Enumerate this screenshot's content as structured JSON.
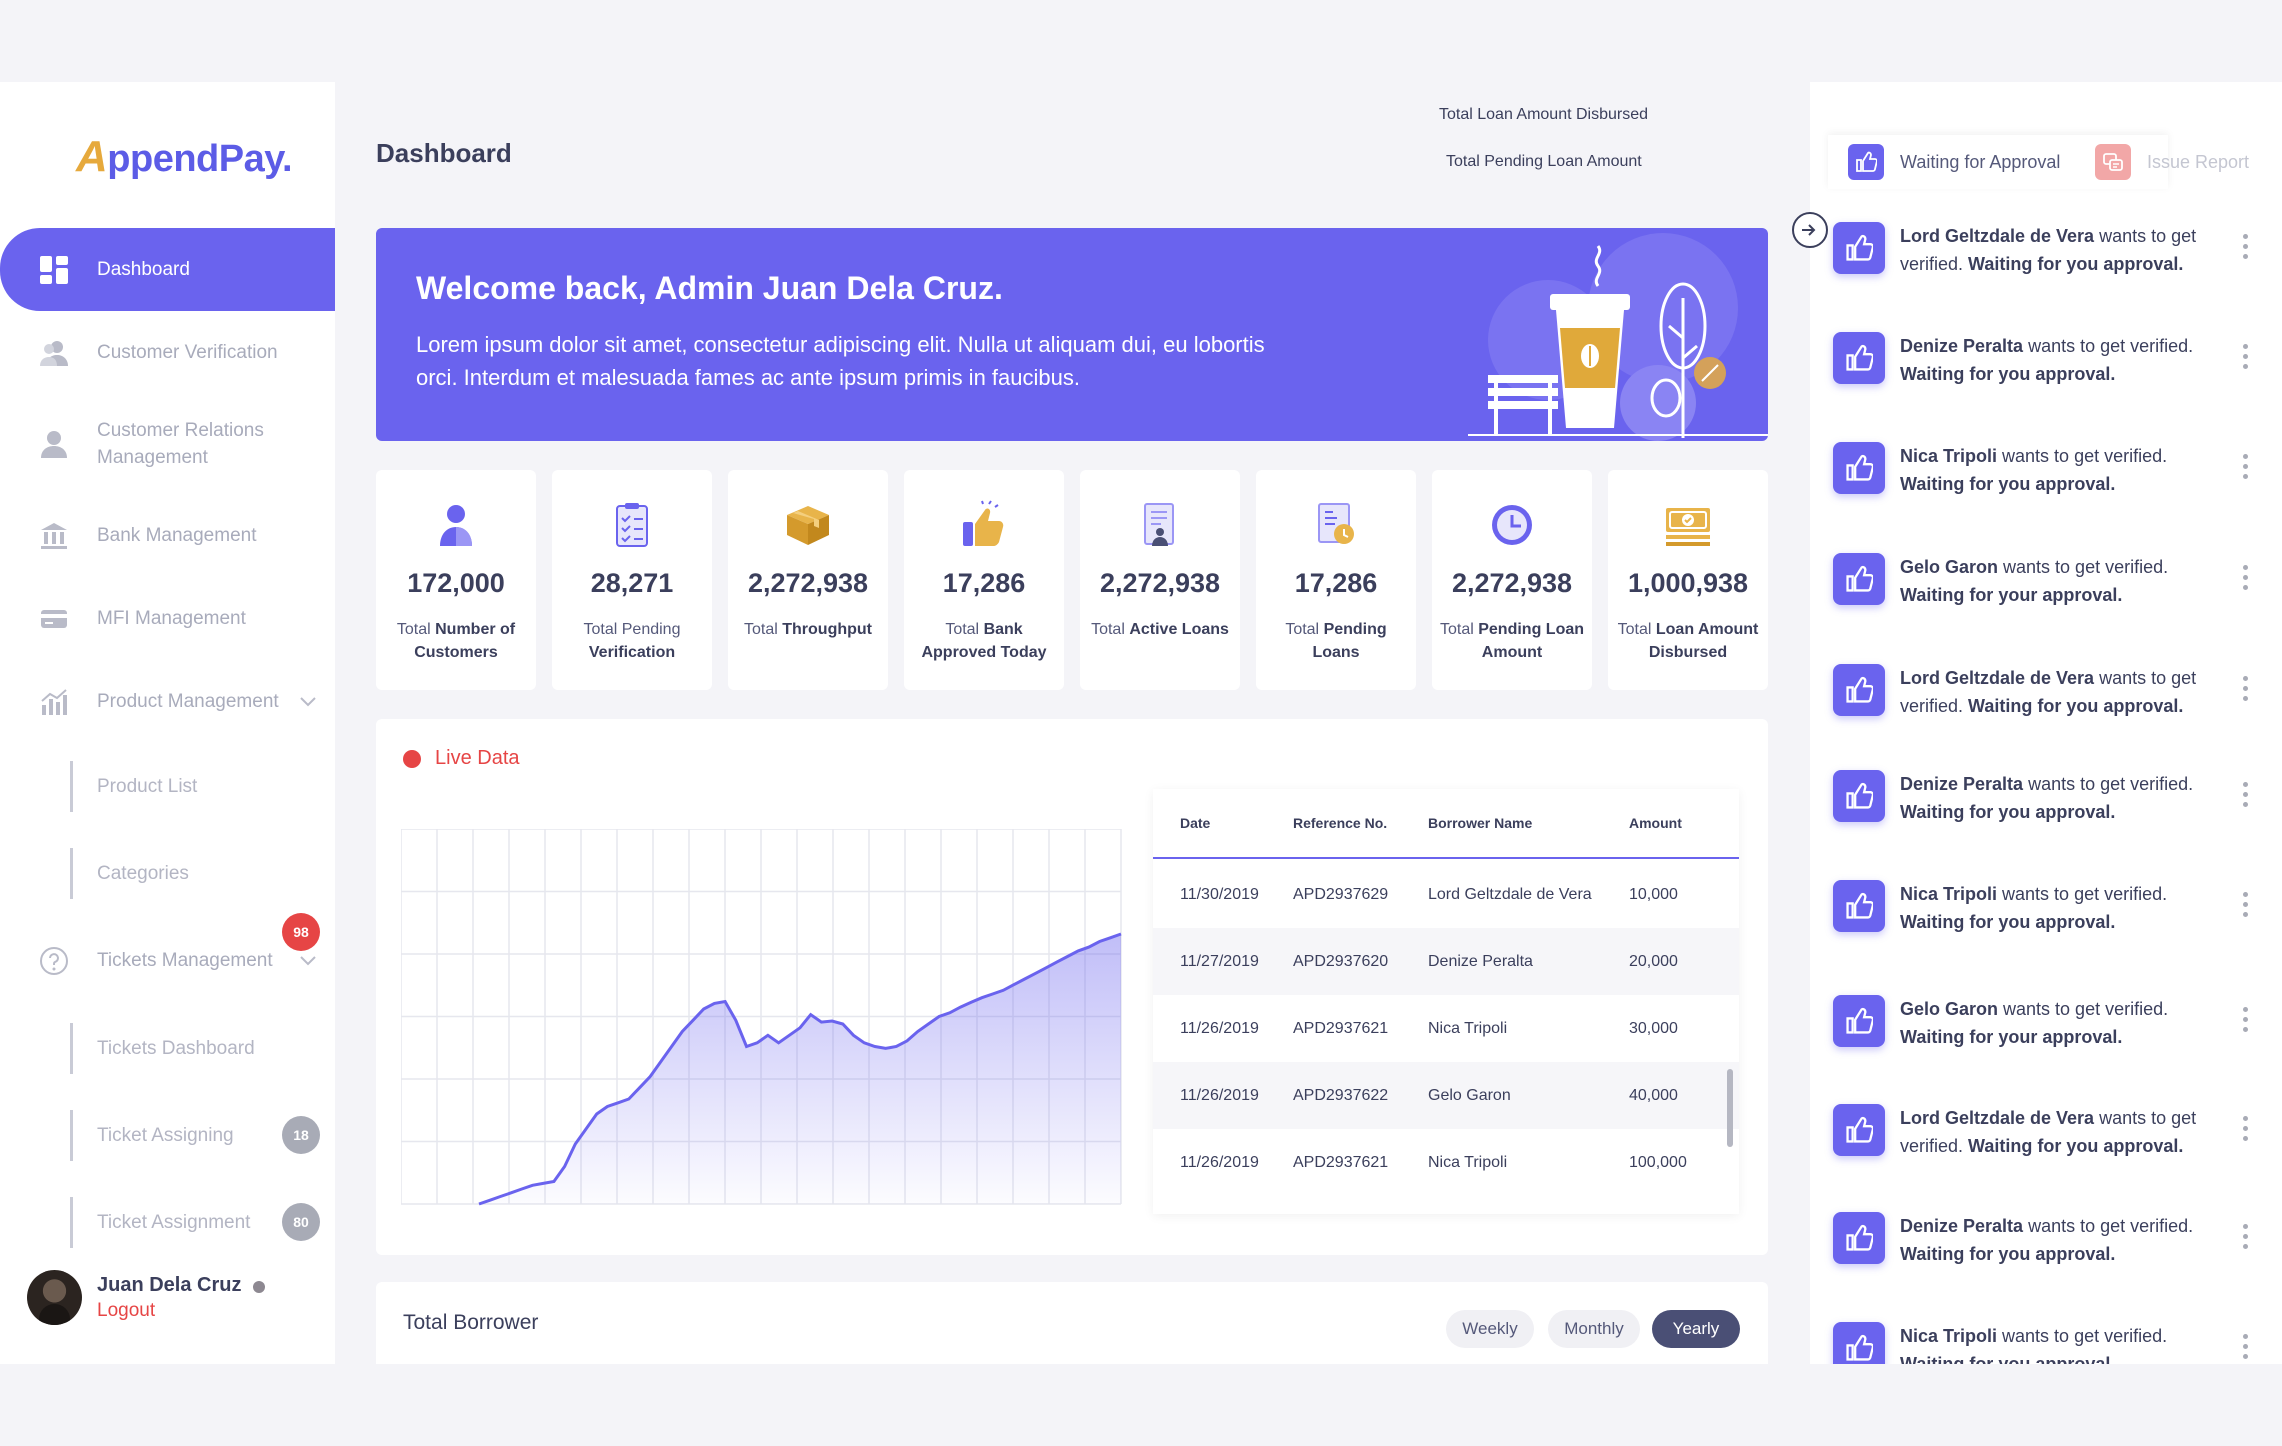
{
  "brand": {
    "logo_initial": "A",
    "logo_rest": "ppendPay."
  },
  "sidebar": {
    "items": [
      {
        "label": "Dashboard"
      },
      {
        "label": "Customer Verification"
      },
      {
        "label": "Customer Relations Management"
      },
      {
        "label": "Bank Management"
      },
      {
        "label": "MFI Management"
      },
      {
        "label": "Product Management"
      },
      {
        "label": "Product List"
      },
      {
        "label": "Categories"
      },
      {
        "label": "Tickets Management",
        "badge": "98"
      },
      {
        "label": "Tickets Dashboard"
      },
      {
        "label": "Ticket Assigning",
        "badge": "18"
      },
      {
        "label": "Ticket Assignment",
        "badge": "80"
      }
    ],
    "user": {
      "name": "Juan Dela Cruz",
      "logout_label": "Logout"
    }
  },
  "header": {
    "title": "Dashboard",
    "stat1_label": "Total Loan Amount Disbursed",
    "stat2_label": "Total Pending Loan Amount"
  },
  "banner": {
    "title": "Welcome back, Admin Juan Dela Cruz.",
    "text": "Lorem ipsum dolor sit amet, consectetur adipiscing elit. Nulla ut aliquam dui, eu lobortis orci. Interdum et malesuada fames ac ante ipsum primis in faucibus.",
    "cup_label": "Coffee"
  },
  "stats": [
    {
      "value": "172,000",
      "prefix": "Total ",
      "bold": "Number of Customers",
      "suffix": "",
      "icon": "user-icon"
    },
    {
      "value": "28,271",
      "prefix": "Total Pending ",
      "bold": "Verification",
      "suffix": "",
      "icon": "checklist-icon"
    },
    {
      "value": "2,272,938",
      "prefix": "Total ",
      "bold": "Throughput",
      "suffix": "",
      "icon": "box-icon"
    },
    {
      "value": "17,286",
      "prefix": "Total ",
      "bold": "Bank Approved Today",
      "suffix": "",
      "icon": "thumbs-up-icon"
    },
    {
      "value": "2,272,938",
      "prefix": "Total ",
      "bold": "Active Loans",
      "suffix": "",
      "icon": "document-user-icon"
    },
    {
      "value": "17,286",
      "prefix": "Total ",
      "bold": "Pending Loans",
      "suffix": "",
      "icon": "document-coin-icon"
    },
    {
      "value": "2,272,938",
      "prefix": "Total ",
      "bold": "Pending Loan Amount",
      "suffix": "",
      "icon": "clock-icon"
    },
    {
      "value": "1,000,938",
      "prefix": "Total ",
      "bold": "Loan Amount Disbursed",
      "suffix": "",
      "icon": "cash-icon"
    }
  ],
  "live": {
    "title": "Live Data",
    "columns": [
      "Date",
      "Reference No.",
      "Borrower Name",
      "Amount"
    ],
    "rows": [
      [
        "11/30/2019",
        "APD2937629",
        "Lord Geltzdale de Vera",
        "10,000"
      ],
      [
        "11/27/2019",
        "APD2937620",
        "Denize Peralta",
        "20,000"
      ],
      [
        "11/26/2019",
        "APD2937621",
        "Nica Tripoli",
        "30,000"
      ],
      [
        "11/26/2019",
        "APD2937622",
        "Gelo Garon",
        "40,000"
      ],
      [
        "11/26/2019",
        "APD2937621",
        "Nica Tripoli",
        "100,000"
      ]
    ]
  },
  "chart_data": {
    "type": "area",
    "title": "",
    "xlabel": "",
    "ylabel": "",
    "grid": true,
    "ylim": [
      0,
      100
    ],
    "x": [
      0,
      1,
      2,
      3,
      4,
      5,
      6,
      7,
      8,
      9,
      10,
      11,
      12,
      13,
      14,
      15,
      16,
      17,
      18,
      19,
      20,
      21,
      22,
      23,
      24,
      25,
      26,
      27,
      28,
      29,
      30,
      31,
      32,
      33,
      34,
      35,
      36,
      37,
      38,
      39,
      40,
      41,
      42,
      43,
      44,
      45,
      46,
      47,
      48,
      49,
      50,
      51,
      52,
      53,
      54,
      55,
      56,
      57,
      58,
      59,
      60
    ],
    "series": [
      {
        "values": [
          0,
          1,
          2,
          3,
          4,
          5,
          5.5,
          6,
          10,
          16,
          20,
          24,
          26,
          27,
          28,
          31,
          34,
          38,
          42,
          46,
          49,
          52,
          53.5,
          54,
          49,
          42,
          43,
          45,
          43,
          45,
          47,
          50.5,
          48.5,
          48.8,
          48,
          45,
          43,
          42,
          41.5,
          42,
          43.5,
          46,
          48,
          50,
          51,
          52.5,
          53.8,
          55,
          56,
          57,
          58.5,
          60,
          61.5,
          63,
          64.5,
          66,
          67.5,
          68.5,
          70,
          71,
          72
        ]
      }
    ],
    "color": "#6a63ee"
  },
  "borrower": {
    "title": "Total Borrower",
    "periods": [
      "Weekly",
      "Monthly",
      "Yearly"
    ],
    "selected": "Yearly"
  },
  "right_panel": {
    "tabs": [
      {
        "label": "Waiting for Approval"
      },
      {
        "label": "Issue Report"
      }
    ],
    "notifications": [
      {
        "name": "Lord Geltzdale de Vera",
        "action": " wants to get verified. ",
        "status": "Waiting for you approval."
      },
      {
        "name": "Denize Peralta",
        "action": " wants to get verified. ",
        "status": "Waiting for you approval."
      },
      {
        "name": "Nica Tripoli",
        "action": " wants to get verified. ",
        "status": "Waiting for you approval."
      },
      {
        "name": "Gelo Garon",
        "action": " wants to get verified. ",
        "status": "Waiting for your approval."
      },
      {
        "name": "Lord Geltzdale de Vera",
        "action": " wants to get verified. ",
        "status": "Waiting for you approval."
      },
      {
        "name": "Denize Peralta",
        "action": " wants to get verified. ",
        "status": "Waiting for you approval."
      },
      {
        "name": "Nica Tripoli",
        "action": " wants to get verified. ",
        "status": "Waiting for you approval."
      },
      {
        "name": "Gelo Garon",
        "action": " wants to get verified. ",
        "status": "Waiting for your approval."
      },
      {
        "name": "Lord Geltzdale de Vera",
        "action": " wants to get verified. ",
        "status": "Waiting for you approval."
      },
      {
        "name": "Denize Peralta",
        "action": " wants to get verified. ",
        "status": "Waiting for you approval."
      },
      {
        "name": "Nica Tripoli",
        "action": " wants to get verified. ",
        "status": "Waiting for you approval."
      }
    ]
  },
  "colors": {
    "accent": "#6a63ee",
    "danger": "#e64545",
    "gold": "#e0a93a"
  }
}
